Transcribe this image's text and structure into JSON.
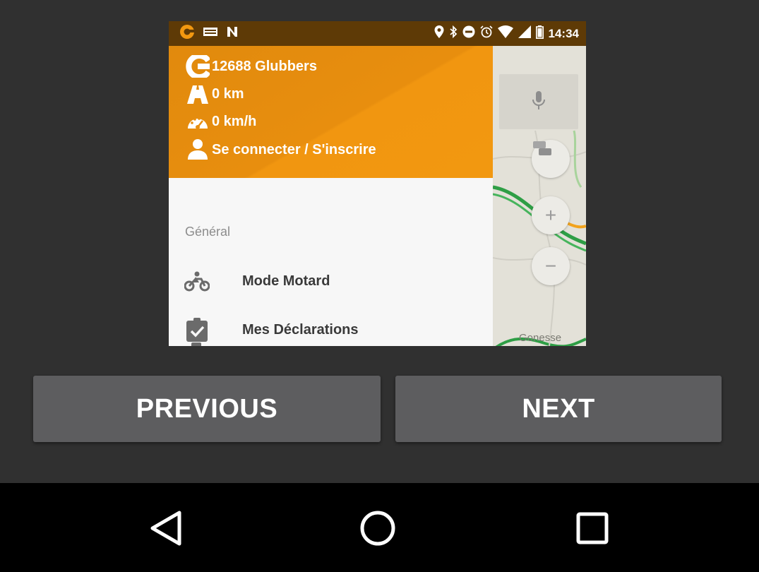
{
  "statusbar": {
    "time": "14:34",
    "left_icons": [
      "app-notification-icon",
      "card-icon",
      "n-icon"
    ],
    "right_icons": [
      "location-icon",
      "bluetooth-icon",
      "do-not-disturb-icon",
      "alarm-icon",
      "wifi-icon",
      "signal-icon",
      "battery-icon"
    ]
  },
  "drawer": {
    "header": {
      "glubbers": "12688 Glubbers",
      "distance": "0 km",
      "speed": "0 km/h",
      "account": "Se connecter / S'inscrire"
    },
    "section_label": "Général",
    "items": [
      {
        "label": "Mode Motard",
        "icon": "motorcycle-icon"
      },
      {
        "label": "Mes Déclarations",
        "icon": "clipboard-check-icon"
      }
    ]
  },
  "map": {
    "place_label": "Gonesse"
  },
  "buttons": {
    "previous": "PREVIOUS",
    "next": "NEXT"
  },
  "colors": {
    "drawer_orange": "#f29810",
    "statusbar": "#5e3a06",
    "button": "#5d5d5f",
    "background": "#303030"
  }
}
